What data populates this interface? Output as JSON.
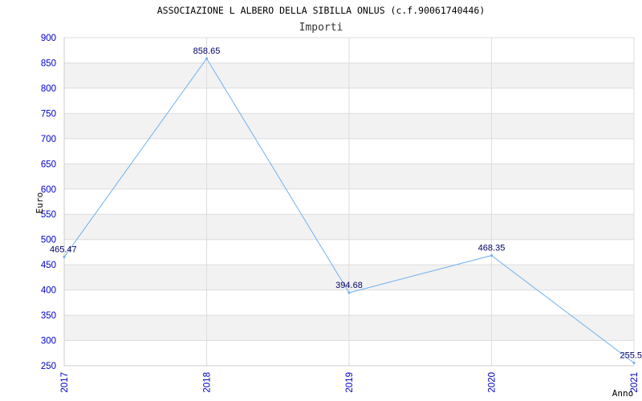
{
  "colors": {
    "line": "#6fb1ee",
    "tick_text": "#0000cc",
    "data_label": "#000066",
    "band": "#f2f2f2",
    "grid": "#dddddd"
  },
  "chart_data": {
    "type": "line",
    "title": "ASSOCIAZIONE L ALBERO DELLA SIBILLA ONLUS (c.f.90061740446)",
    "subtitle": "Importi",
    "xlabel": "Anno",
    "ylabel": "Euro",
    "x": [
      "2017",
      "2018",
      "2019",
      "2020",
      "2021"
    ],
    "series": [
      {
        "values": [
          465.47,
          858.65,
          394.68,
          468.35,
          255.5
        ]
      }
    ],
    "data_labels": [
      "465.47",
      "858.65",
      "394.68",
      "468.35",
      "255.5"
    ],
    "y_ticks": [
      250,
      300,
      350,
      400,
      450,
      500,
      550,
      600,
      650,
      700,
      750,
      800,
      850,
      900
    ],
    "ylim": [
      250,
      900
    ],
    "grid": true,
    "legend": "none"
  }
}
